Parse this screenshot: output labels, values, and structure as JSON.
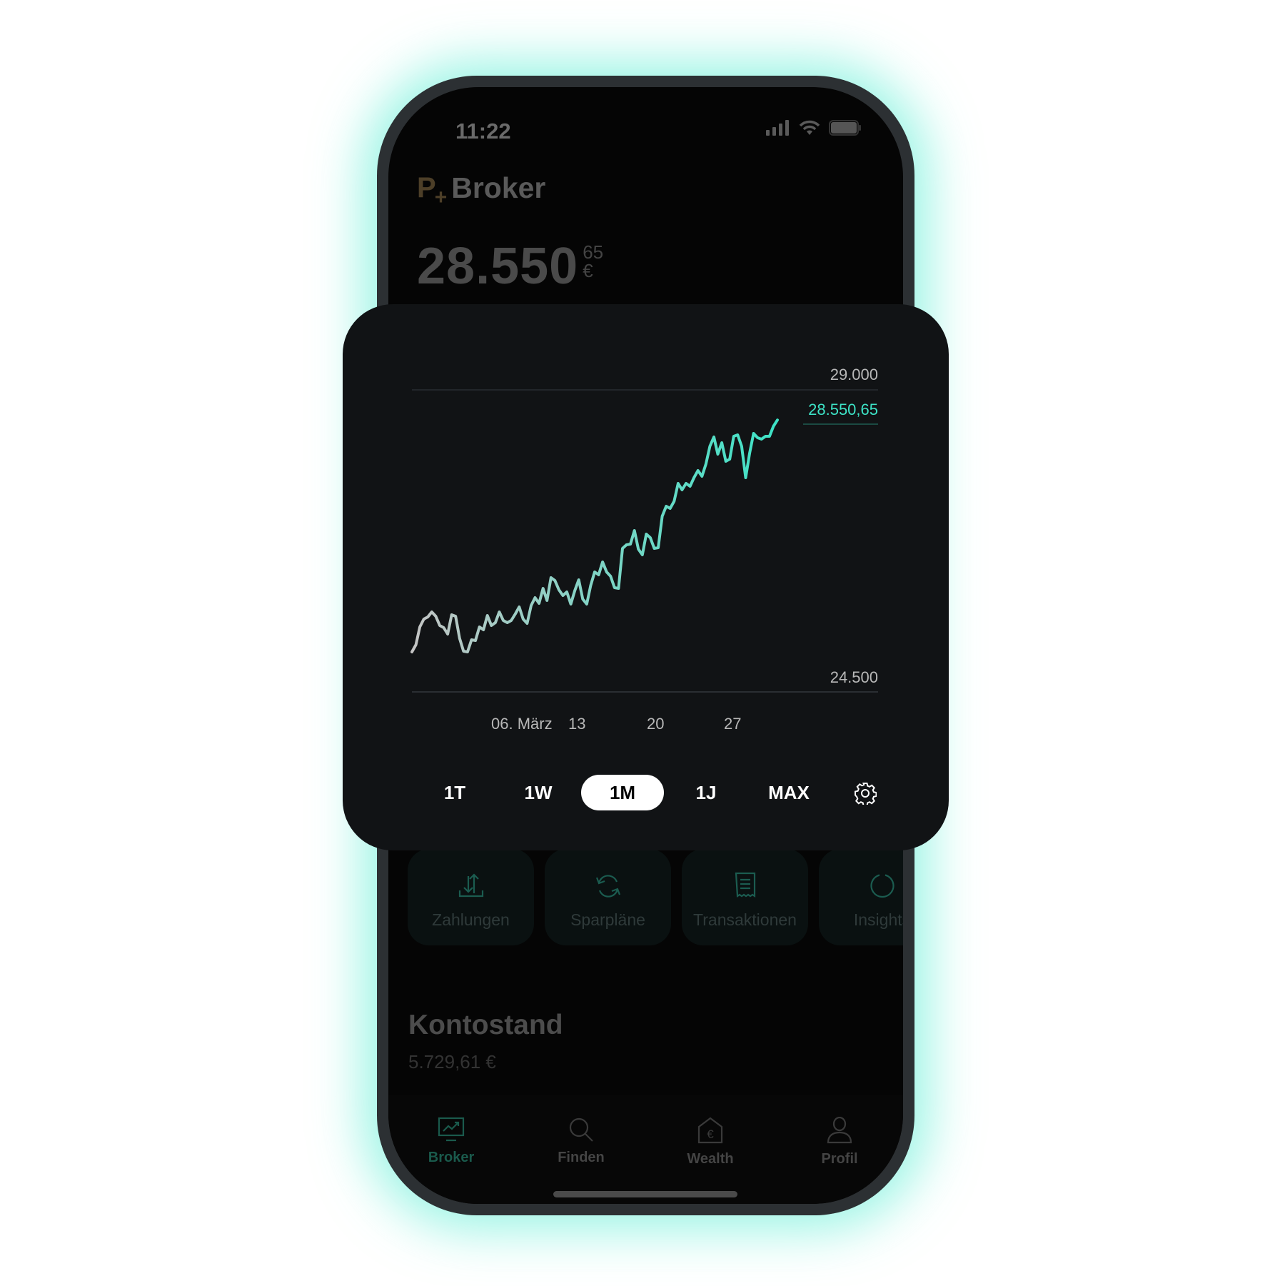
{
  "status_bar": {
    "time": "11:22",
    "icons": [
      "signal-icon",
      "wifi-icon",
      "battery-icon"
    ]
  },
  "header": {
    "logo": "P+",
    "title": "Broker"
  },
  "portfolio": {
    "value_main": "28.550",
    "value_cents": "65",
    "currency": "€"
  },
  "chart_data": {
    "type": "line",
    "ylim": [
      24500,
      29000
    ],
    "y_ticks": [
      "29.000",
      "24.500"
    ],
    "x_ticks": [
      "06. März",
      "13",
      "20",
      "27"
    ],
    "current_value_label": "28.550,65",
    "line_color_start": "#c4c4c4",
    "line_color_end": "#3de3c6",
    "grid": true,
    "values": [
      25096,
      25202,
      25468,
      25585,
      25617,
      25691,
      25628,
      25489,
      25457,
      25362,
      25649,
      25628,
      25298,
      25106,
      25096,
      25277,
      25266,
      25468,
      25426,
      25638,
      25489,
      25532,
      25691,
      25564,
      25532,
      25564,
      25660,
      25766,
      25585,
      25521,
      25787,
      25904,
      25819,
      26043,
      25862,
      26202,
      26160,
      26021,
      25936,
      25989,
      25809,
      26011,
      26170,
      25883,
      25809,
      26085,
      26287,
      26245,
      26436,
      26287,
      26223,
      26053,
      26043,
      26638,
      26691,
      26702,
      26904,
      26628,
      26543,
      26851,
      26798,
      26638,
      26649,
      27117,
      27266,
      27234,
      27340,
      27606,
      27511,
      27606,
      27564,
      27691,
      27798,
      27713,
      27894,
      28160,
      28298,
      28043,
      28213,
      27936,
      27968,
      28309,
      28330,
      28160,
      27691,
      28053,
      28351,
      28287,
      28266,
      28309,
      28309,
      28457,
      28550.65
    ]
  },
  "ranges": {
    "items": [
      "1T",
      "1W",
      "1M",
      "1J",
      "MAX"
    ],
    "selected": "1M"
  },
  "tiles": [
    {
      "label": "Zahlungen",
      "icon": "transfer-icon"
    },
    {
      "label": "Sparpläne",
      "icon": "refresh-icon"
    },
    {
      "label": "Transaktionen",
      "icon": "receipt-icon"
    },
    {
      "label": "Insights",
      "icon": "donut-icon"
    }
  ],
  "account": {
    "title": "Kontostand",
    "value": "5.729,61 €"
  },
  "nav": [
    {
      "label": "Broker",
      "icon": "chart-monitor-icon",
      "active": true
    },
    {
      "label": "Finden",
      "icon": "search-icon"
    },
    {
      "label": "Wealth",
      "icon": "euro-house-icon"
    },
    {
      "label": "Profil",
      "icon": "user-icon"
    }
  ],
  "colors": {
    "accent": "#3de3c6",
    "nav_active": "#1a5a4c",
    "logo": "#4d3f28"
  }
}
